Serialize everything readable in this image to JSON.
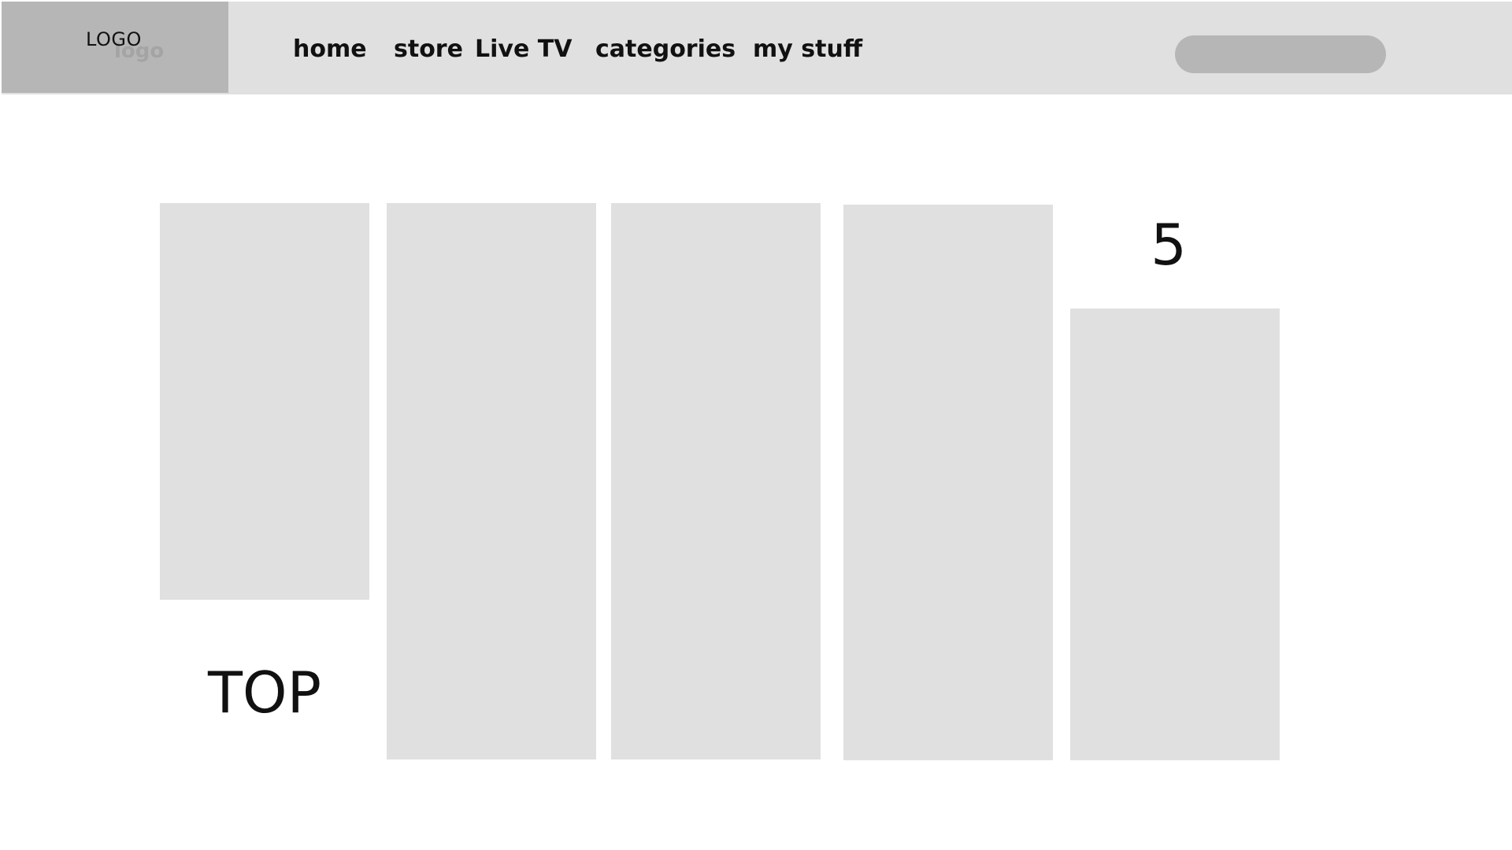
{
  "header": {
    "logo_text": "LOGO",
    "logo_ghost_text": "logo",
    "nav": [
      {
        "label": "home"
      },
      {
        "label": "store"
      },
      {
        "label": "Live TV"
      },
      {
        "label": "categories"
      },
      {
        "label": "my stuff"
      }
    ],
    "search": {
      "value": "",
      "placeholder": ""
    }
  },
  "main": {
    "top_label": "TOP",
    "rank_label": "5"
  },
  "colors": {
    "header_bg": "#e0e0e0",
    "logo_bg": "#b6b6b6",
    "tile_bg": "#e0e0e0",
    "search_bg": "#b6b6b6"
  }
}
